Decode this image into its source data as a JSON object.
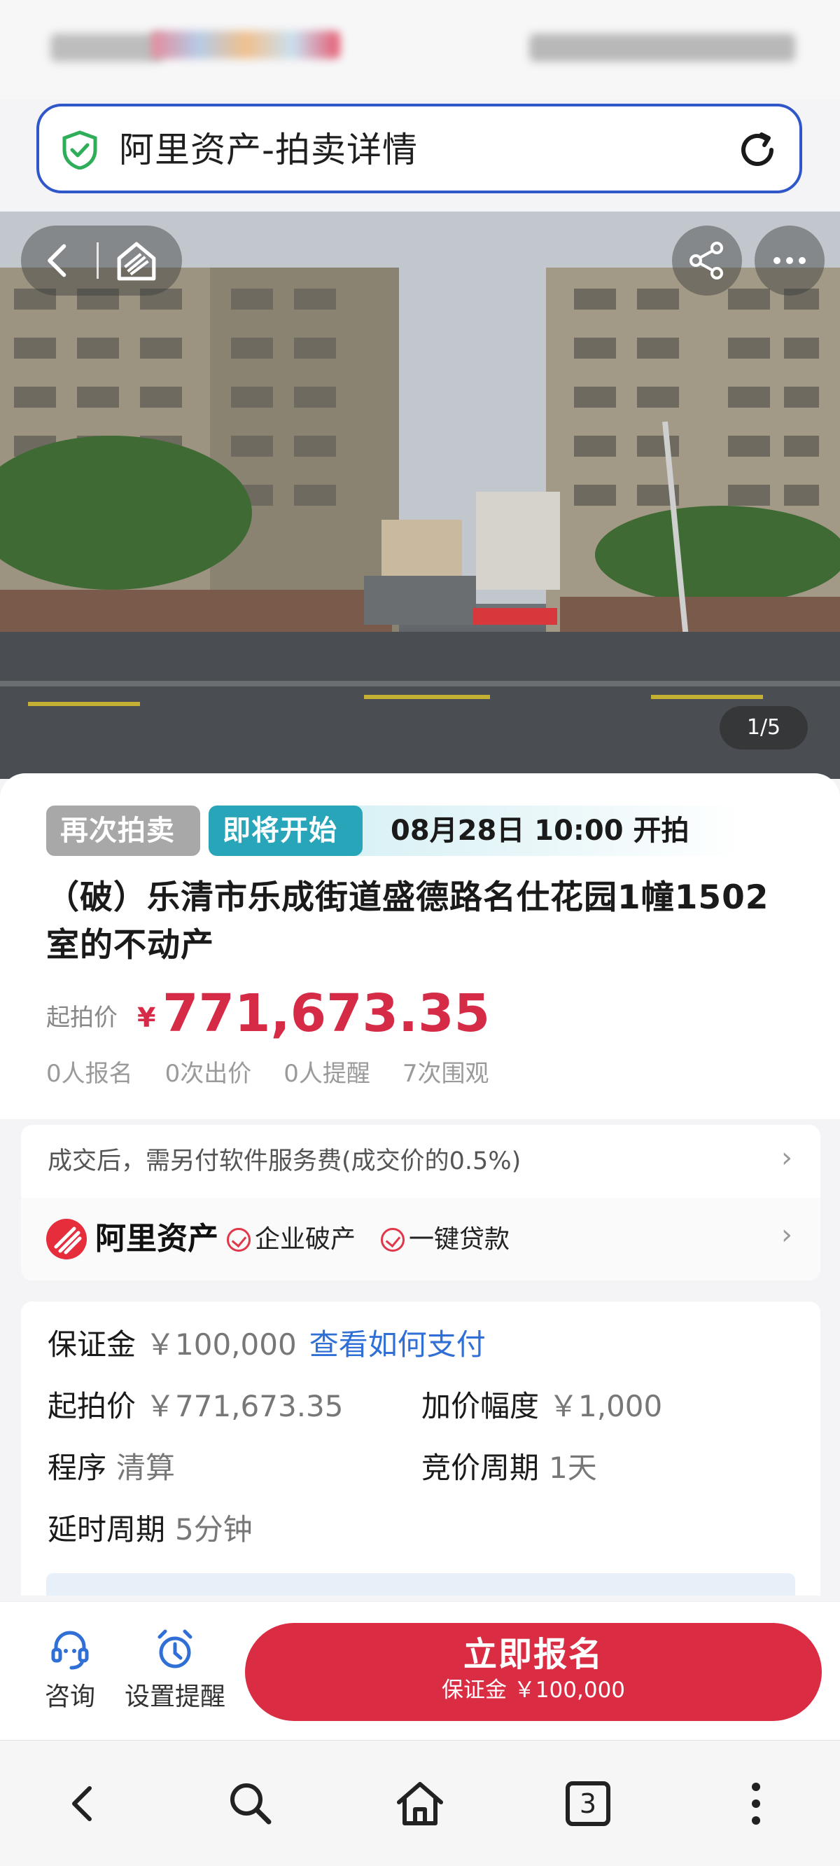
{
  "browser": {
    "page_title": "阿里资产-拍卖详情",
    "tab_count": "3"
  },
  "gallery": {
    "counter": "1/5"
  },
  "auction": {
    "tag_retry": "再次拍卖",
    "tag_status": "即将开始",
    "start_time": "08月28日 10:00 开拍",
    "title": "（破）乐清市乐成街道盛德路名仕花园1幢1502室的不动产",
    "price_label": "起拍价",
    "price_currency": "¥",
    "price_value": "771,673.35",
    "stats": [
      "0人报名",
      "0次出价",
      "0人提醒",
      "7次围观"
    ]
  },
  "fee": {
    "text": "成交后，需另付软件服务费(成交价的0.5%)"
  },
  "brand": {
    "name": "阿里资产",
    "feature_1": "企业破产",
    "feature_2": "一键贷款"
  },
  "details": {
    "deposit_label": "保证金",
    "deposit_value": "￥100,000",
    "deposit_link": "查看如何支付",
    "start_price_label": "起拍价",
    "start_price_value": "￥771,673.35",
    "increment_label": "加价幅度",
    "increment_value": "￥1,000",
    "procedure_label": "程序",
    "procedure_value": "清算",
    "cycle_label": "竞价周期",
    "cycle_value": "1天",
    "delay_label": "延时周期",
    "delay_value": "5分钟"
  },
  "actions": {
    "consult": "咨询",
    "reminder": "设置提醒",
    "signup_main": "立即报名",
    "signup_sub": "保证金 ￥100,000"
  },
  "colors": {
    "accent_red": "#da2c43",
    "teal": "#29a5b9",
    "link_blue": "#2f6fd6",
    "url_border": "#2f57c9"
  }
}
